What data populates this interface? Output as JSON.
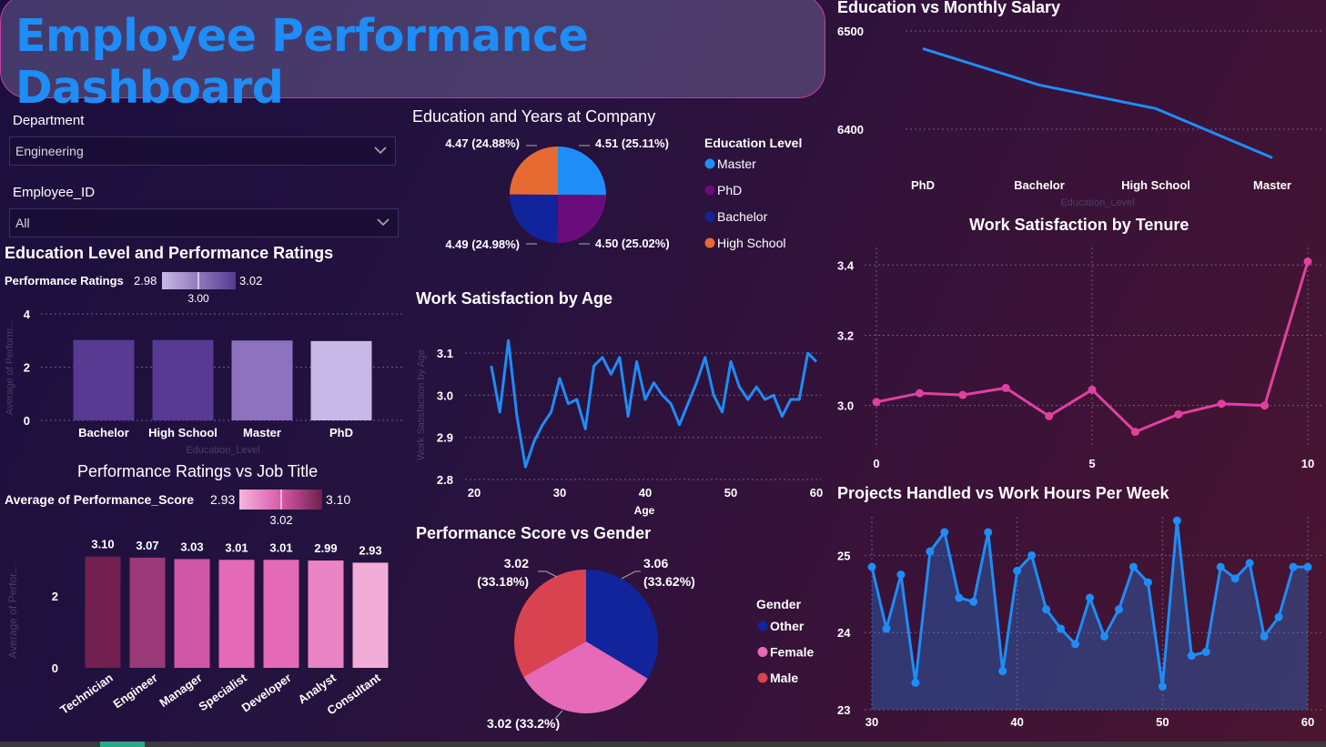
{
  "header": {
    "title": "Employee Performance Dashboard"
  },
  "filters": {
    "department": {
      "label": "Department",
      "value": "Engineering"
    },
    "employee": {
      "label": "Employee_ID",
      "value": "All"
    }
  },
  "colors": {
    "blue": "#1e8df7",
    "pink": "#e0409f",
    "dark_blue": "#12249c",
    "purple": "#6a0c7a",
    "orange": "#e86a33",
    "red": "#d8434f",
    "female_pink": "#e66ab8"
  },
  "chart_data": [
    {
      "id": "edu_perf",
      "type": "bar",
      "title": "Education Level and Performance Ratings",
      "xlabel": "Education_Level",
      "ylabel": "Average of Perform...",
      "ylim": [
        0,
        4
      ],
      "yticks": [
        "0",
        "2",
        "4"
      ],
      "categories": [
        "Bachelor",
        "High School",
        "Master",
        "PhD"
      ],
      "values": [
        3.02,
        3.02,
        3.0,
        2.98
      ],
      "colors": [
        "#573a91",
        "#573a91",
        "#8d72bf",
        "#c8b8e8"
      ],
      "legend": {
        "label": "Performance Ratings",
        "min": "2.98",
        "mid": "3.00",
        "max": "3.02"
      }
    },
    {
      "id": "perf_job",
      "type": "bar",
      "title": "Performance Ratings vs Job Title",
      "ylabel": "Average of Perfor...",
      "ylim": [
        0,
        3.6
      ],
      "yticks": [
        "0",
        "2"
      ],
      "categories": [
        "Technician",
        "Engineer",
        "Manager",
        "Specialist",
        "Developer",
        "Analyst",
        "Consultant"
      ],
      "values": [
        3.1,
        3.07,
        3.03,
        3.01,
        3.01,
        2.99,
        2.93
      ],
      "labels": [
        "3.10",
        "3.07",
        "3.03",
        "3.01",
        "3.01",
        "2.99",
        "2.93"
      ],
      "colors": [
        "#72204f",
        "#9b3a79",
        "#cf56a6",
        "#e46ab8",
        "#e46ab8",
        "#eb84c4",
        "#f1acd7"
      ],
      "legend": {
        "label": "Average of Performance_Score",
        "min": "2.93",
        "mid": "3.02",
        "max": "3.10"
      }
    },
    {
      "id": "edu_years",
      "type": "pie",
      "title": "Education and Years at Company",
      "legend_title": "Education Level",
      "slices": [
        {
          "name": "Master",
          "value": 4.51,
          "label": "4.51 (25.11%)",
          "color": "#1e8df7"
        },
        {
          "name": "PhD",
          "value": 4.5,
          "label": "4.50 (25.02%)",
          "color": "#6a0c7a"
        },
        {
          "name": "Bachelor",
          "value": 4.49,
          "label": "4.49 (24.98%)",
          "color": "#12249c"
        },
        {
          "name": "High School",
          "value": 4.47,
          "label": "4.47 (24.88%)",
          "color": "#e86a33"
        }
      ]
    },
    {
      "id": "sat_age",
      "type": "line",
      "title": "Work Satisfaction by Age",
      "xlabel": "Age",
      "ylabel": "Work Satisfaction by Age",
      "xlim": [
        20,
        60
      ],
      "ylim": [
        2.8,
        3.15
      ],
      "xticks": [
        "20",
        "30",
        "40",
        "50",
        "60"
      ],
      "yticks": [
        "2.8",
        "2.9",
        "3.0",
        "3.1"
      ],
      "x": [
        22,
        23,
        24,
        25,
        26,
        27,
        28,
        29,
        30,
        31,
        32,
        33,
        34,
        35,
        36,
        37,
        38,
        39,
        40,
        41,
        42,
        43,
        44,
        45,
        46,
        47,
        48,
        49,
        50,
        51,
        52,
        53,
        54,
        55,
        56,
        57,
        58,
        59,
        60
      ],
      "y": [
        3.07,
        2.96,
        3.13,
        2.95,
        2.83,
        2.89,
        2.93,
        2.96,
        3.04,
        2.98,
        2.99,
        2.92,
        3.07,
        3.09,
        3.05,
        3.09,
        2.95,
        3.08,
        2.99,
        3.03,
        3.0,
        2.98,
        2.93,
        2.98,
        3.03,
        3.09,
        3.0,
        2.96,
        3.08,
        3.02,
        2.99,
        3.02,
        2.99,
        3.0,
        2.95,
        2.99,
        2.99,
        3.1,
        3.08
      ]
    },
    {
      "id": "perf_gender",
      "type": "pie",
      "title": "Performance Score vs Gender",
      "legend_title": "Gender",
      "slices": [
        {
          "name": "Other",
          "value": 3.06,
          "label_top": "3.06",
          "label_bottom": "(33.62%)",
          "color": "#12249c"
        },
        {
          "name": "Female",
          "value": 3.02,
          "label_top": "3.02 (33.2%)",
          "label_bottom": "",
          "color": "#e66ab8"
        },
        {
          "name": "Male",
          "value": 3.02,
          "label_top": "3.02",
          "label_bottom": "(33.18%)",
          "color": "#d8434f"
        }
      ]
    },
    {
      "id": "edu_salary",
      "type": "line",
      "title": "Education vs Monthly Salary",
      "xlabel": "Education_Level",
      "categories": [
        "PhD",
        "Bachelor",
        "High School",
        "Master"
      ],
      "values": [
        6482,
        6445,
        6421,
        6371
      ],
      "ylim": [
        6350,
        6500
      ],
      "yticks": [
        "6400",
        "6500"
      ]
    },
    {
      "id": "sat_tenure",
      "type": "line",
      "title": "Work Satisfaction by Tenure",
      "xlim": [
        0,
        10
      ],
      "ylim": [
        2.88,
        3.45
      ],
      "xticks": [
        "0",
        "5",
        "10"
      ],
      "yticks": [
        "3.0",
        "3.2",
        "3.4"
      ],
      "x": [
        0,
        1,
        2,
        3,
        4,
        5,
        6,
        7,
        8,
        9,
        10
      ],
      "y": [
        3.01,
        3.035,
        3.03,
        3.05,
        2.97,
        3.045,
        2.925,
        2.975,
        3.005,
        3.0,
        3.41
      ]
    },
    {
      "id": "proj_hours",
      "type": "area",
      "title": "Projects Handled vs Work Hours Per Week",
      "xlim": [
        30,
        60
      ],
      "ylim": [
        23,
        25.5
      ],
      "xticks": [
        "30",
        "40",
        "50",
        "60"
      ],
      "yticks": [
        "23",
        "24",
        "25"
      ],
      "x": [
        30,
        31,
        32,
        33,
        34,
        35,
        36,
        37,
        38,
        39,
        40,
        41,
        42,
        43,
        44,
        45,
        46,
        47,
        48,
        49,
        50,
        51,
        52,
        53,
        54,
        55,
        56,
        57,
        58,
        59,
        60
      ],
      "y": [
        24.85,
        24.05,
        24.75,
        23.35,
        25.05,
        25.3,
        24.45,
        24.4,
        25.3,
        23.5,
        24.8,
        25.0,
        24.3,
        24.05,
        23.85,
        24.45,
        23.95,
        24.3,
        24.85,
        24.65,
        23.3,
        25.45,
        23.7,
        23.75,
        24.85,
        24.7,
        24.9,
        23.95,
        24.2,
        24.85,
        24.85
      ]
    }
  ]
}
